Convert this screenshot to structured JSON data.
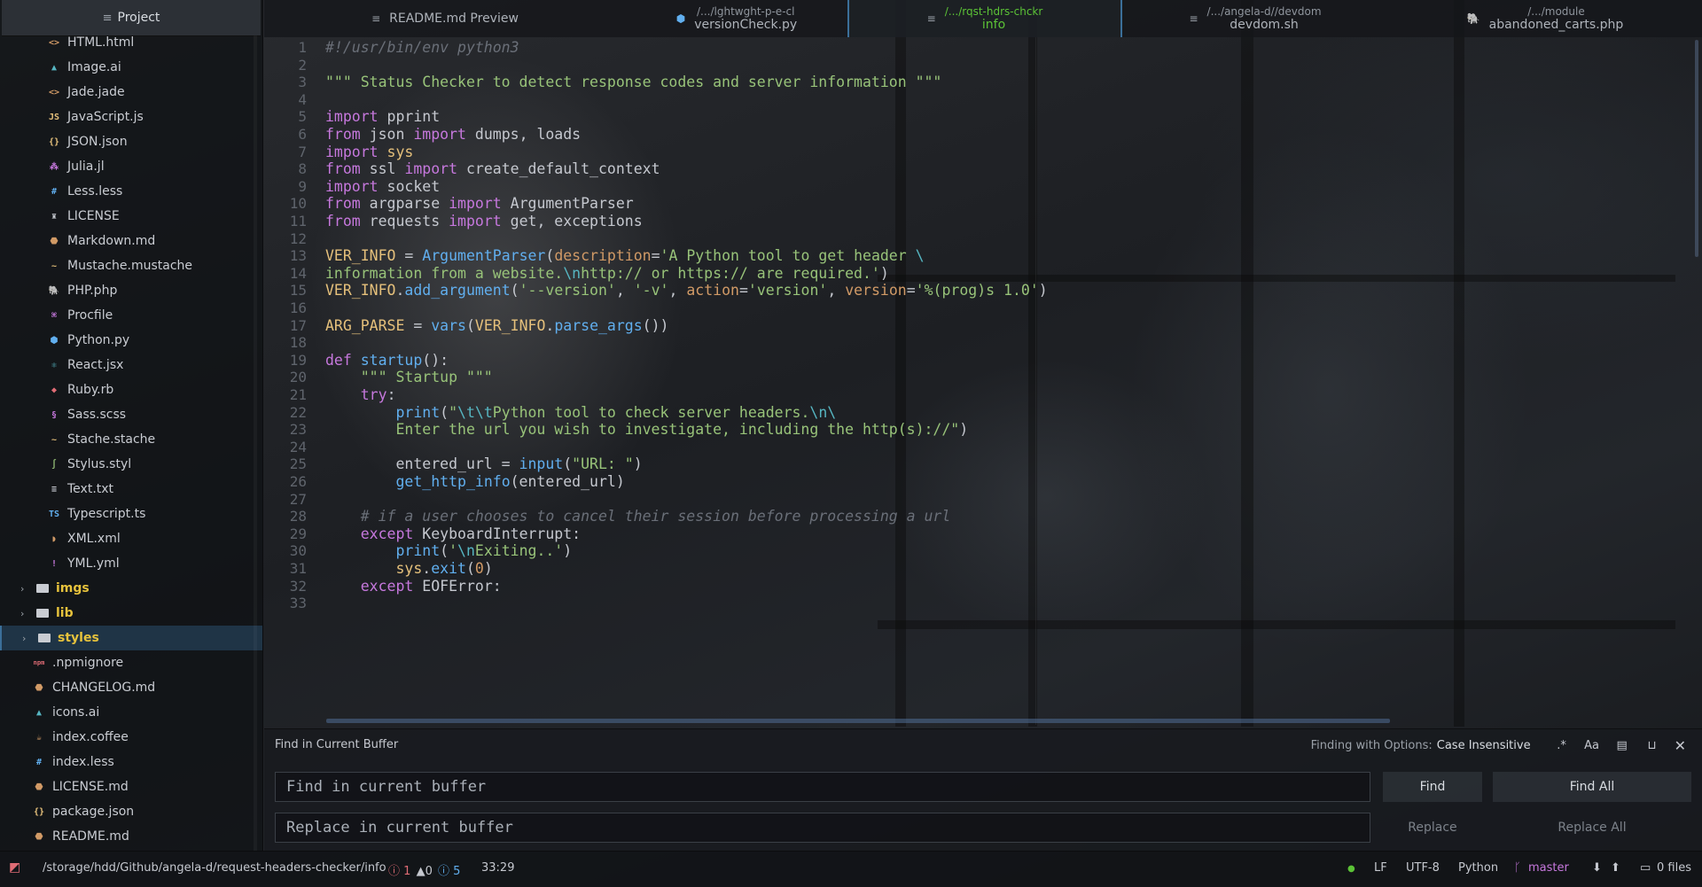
{
  "sidebar": {
    "title": "Project",
    "items": [
      {
        "label": "HTML.html",
        "icon": "code-file-icon",
        "glyph": "<>",
        "color": "#d19a66",
        "type": "file",
        "level": 2
      },
      {
        "label": "Image.ai",
        "icon": "image-file-icon",
        "glyph": "▲",
        "color": "#56b6c2",
        "type": "file",
        "level": 2
      },
      {
        "label": "Jade.jade",
        "icon": "code-file-icon",
        "glyph": "<>",
        "color": "#d19a66",
        "type": "file",
        "level": 2
      },
      {
        "label": "JavaScript.js",
        "icon": "javascript-file-icon",
        "glyph": "JS",
        "color": "#e5c07b",
        "type": "file",
        "level": 2
      },
      {
        "label": "JSON.json",
        "icon": "json-file-icon",
        "glyph": "{}",
        "color": "#e5c07b",
        "type": "file",
        "level": 2
      },
      {
        "label": "Julia.jl",
        "icon": "julia-file-icon",
        "glyph": "⁂",
        "color": "#c678dd",
        "type": "file",
        "level": 2
      },
      {
        "label": "Less.less",
        "icon": "less-file-icon",
        "glyph": "#",
        "color": "#61afef",
        "type": "file",
        "level": 2
      },
      {
        "label": "LICENSE",
        "icon": "license-file-icon",
        "glyph": "♜",
        "color": "#c5c8cf",
        "type": "file",
        "level": 2
      },
      {
        "label": "Markdown.md",
        "icon": "markdown-file-icon",
        "glyph": "⬣",
        "color": "#d19a66",
        "type": "file",
        "level": 2
      },
      {
        "label": "Mustache.mustache",
        "icon": "mustache-file-icon",
        "glyph": "~",
        "color": "#e5c07b",
        "type": "file",
        "level": 2
      },
      {
        "label": "PHP.php",
        "icon": "php-file-icon",
        "glyph": "🐘",
        "color": "#8f96d8",
        "type": "file",
        "level": 2
      },
      {
        "label": "Procfile",
        "icon": "procfile-icon",
        "glyph": "⌘",
        "color": "#c678dd",
        "type": "file",
        "level": 2
      },
      {
        "label": "Python.py",
        "icon": "python-file-icon",
        "glyph": "⬢",
        "color": "#61afef",
        "type": "file",
        "level": 2
      },
      {
        "label": "React.jsx",
        "icon": "react-file-icon",
        "glyph": "⚛",
        "color": "#56b6c2",
        "type": "file",
        "level": 2
      },
      {
        "label": "Ruby.rb",
        "icon": "ruby-file-icon",
        "glyph": "◆",
        "color": "#e06c75",
        "type": "file",
        "level": 2
      },
      {
        "label": "Sass.scss",
        "icon": "sass-file-icon",
        "glyph": "§",
        "color": "#c678dd",
        "type": "file",
        "level": 2
      },
      {
        "label": "Stache.stache",
        "icon": "stache-file-icon",
        "glyph": "~",
        "color": "#e5c07b",
        "type": "file",
        "level": 2
      },
      {
        "label": "Stylus.styl",
        "icon": "stylus-file-icon",
        "glyph": "∫",
        "color": "#98c379",
        "type": "file",
        "level": 2
      },
      {
        "label": "Text.txt",
        "icon": "text-file-icon",
        "glyph": "≡",
        "color": "#c5c8cf",
        "type": "file",
        "level": 2
      },
      {
        "label": "Typescript.ts",
        "icon": "typescript-file-icon",
        "glyph": "TS",
        "color": "#61afef",
        "type": "file",
        "level": 2
      },
      {
        "label": "XML.xml",
        "icon": "rss-file-icon",
        "glyph": "◗",
        "color": "#d19a66",
        "type": "file",
        "level": 2
      },
      {
        "label": "YML.yml",
        "icon": "yml-file-icon",
        "glyph": "!",
        "color": "#c678dd",
        "type": "file",
        "level": 2
      },
      {
        "label": "imgs",
        "icon": "folder-icon",
        "type": "dir"
      },
      {
        "label": "lib",
        "icon": "folder-icon",
        "type": "dir"
      },
      {
        "label": "styles",
        "icon": "folder-icon",
        "type": "dir",
        "selected": true
      },
      {
        "label": ".npmignore",
        "icon": "npm-file-icon",
        "glyph": "npm",
        "color": "#e06c75",
        "type": "file",
        "level": 1
      },
      {
        "label": "CHANGELOG.md",
        "icon": "markdown-file-icon",
        "glyph": "⬣",
        "color": "#d19a66",
        "type": "file",
        "level": 1
      },
      {
        "label": "icons.ai",
        "icon": "image-file-icon",
        "glyph": "▲",
        "color": "#56b6c2",
        "type": "file",
        "level": 1
      },
      {
        "label": "index.coffee",
        "icon": "coffee-file-icon",
        "glyph": "☕",
        "color": "#d19a66",
        "type": "file",
        "level": 1
      },
      {
        "label": "index.less",
        "icon": "less-file-icon",
        "glyph": "#",
        "color": "#61afef",
        "type": "file",
        "level": 1
      },
      {
        "label": "LICENSE.md",
        "icon": "markdown-file-icon",
        "glyph": "⬣",
        "color": "#d19a66",
        "type": "file",
        "level": 1
      },
      {
        "label": "package.json",
        "icon": "json-file-icon",
        "glyph": "{}",
        "color": "#e5c07b",
        "type": "file",
        "level": 1
      },
      {
        "label": "README.md",
        "icon": "markdown-file-icon",
        "glyph": "⬣",
        "color": "#d19a66",
        "type": "file",
        "level": 1
      }
    ]
  },
  "tabs": [
    {
      "path": "",
      "name": "README.md Preview",
      "icon": "document-icon"
    },
    {
      "path": "/.../lghtwght-p-e-cl",
      "name": "versionCheck.py",
      "icon": "python-file-icon"
    },
    {
      "path": "/.../rqst-hdrs-chckr",
      "name": "info",
      "icon": "document-icon",
      "active": true
    },
    {
      "path": "/.../angela-d//devdom",
      "name": "devdom.sh",
      "icon": "document-icon"
    },
    {
      "path": "/.../module",
      "name": "abandoned_carts.php",
      "icon": "php-file-icon"
    }
  ],
  "editor": {
    "line_numbers": [
      "1",
      "2",
      "3",
      "4",
      "5",
      "6",
      "7",
      "8",
      "9",
      "10",
      "11",
      "12",
      "13",
      "14",
      "15",
      "16",
      "17",
      "18",
      "19",
      "20",
      "21",
      "22",
      "23",
      "24",
      "25",
      "26",
      "27",
      "28",
      "29",
      "30",
      "31",
      "32",
      "33"
    ],
    "lines": [
      "#!/usr/bin/env python3",
      "",
      "\"\"\" Status Checker to detect response codes and server information \"\"\"",
      "",
      "import pprint",
      "from json import dumps, loads",
      "import sys",
      "from ssl import create_default_context",
      "import socket",
      "from argparse import ArgumentParser",
      "from requests import get, exceptions",
      "",
      "VER_INFO = ArgumentParser(description='A Python tool to get header \\",
      "information from a website.\\nhttp:// or https:// are required.')",
      "VER_INFO.add_argument('--version', '-v', action='version', version='%(prog)s 1.0')",
      "",
      "ARG_PARSE = vars(VER_INFO.parse_args())",
      "",
      "def startup():",
      "    \"\"\" Startup \"\"\"",
      "    try:",
      "        print(\"\\t\\tPython tool to check server headers.\\n\\",
      "        Enter the url you wish to investigate, including the http(s)://\")",
      "",
      "        entered_url = input(\"URL: \")",
      "        get_http_info(entered_url)",
      "",
      "    # if a user chooses to cancel their session before processing a url",
      "    except KeyboardInterrupt:",
      "        print('\\nExiting..')",
      "        sys.exit(0)",
      "    except EOFError:",
      ""
    ]
  },
  "find": {
    "title": "Find in Current Buffer",
    "options_label": "Finding with Options:",
    "options_value": "Case Insensitive",
    "option_buttons": [
      {
        "name": "regex-toggle",
        "glyph": ".*"
      },
      {
        "name": "case-sensitive-toggle",
        "glyph": "Aa"
      },
      {
        "name": "in-selection-toggle",
        "glyph": "▤"
      },
      {
        "name": "whole-word-toggle",
        "glyph": "⊔"
      }
    ],
    "find_placeholder": "Find in current buffer",
    "replace_placeholder": "Replace in current buffer",
    "find_label": "Find",
    "find_all_label": "Find All",
    "replace_label": "Replace",
    "replace_all_label": "Replace All"
  },
  "status": {
    "path": "/storage/hdd/Github/angela-d/request-headers-checker/info",
    "errors": "1",
    "warnings": "0",
    "infos": "5",
    "cursor": "33:29",
    "line_ending": "LF",
    "encoding": "UTF-8",
    "grammar": "Python",
    "branch": "master",
    "files": "0 files"
  },
  "colors": {
    "keyword": "#c678dd",
    "string": "#98c379",
    "comment": "#6a6f78",
    "function": "#61afef",
    "variable": "#e5c07b",
    "attribute": "#d19a66",
    "escape": "#56b6c2",
    "active_tab": "#5bc236",
    "branch": "#c678dd",
    "error": "#e06c75",
    "info": "#61afef"
  }
}
